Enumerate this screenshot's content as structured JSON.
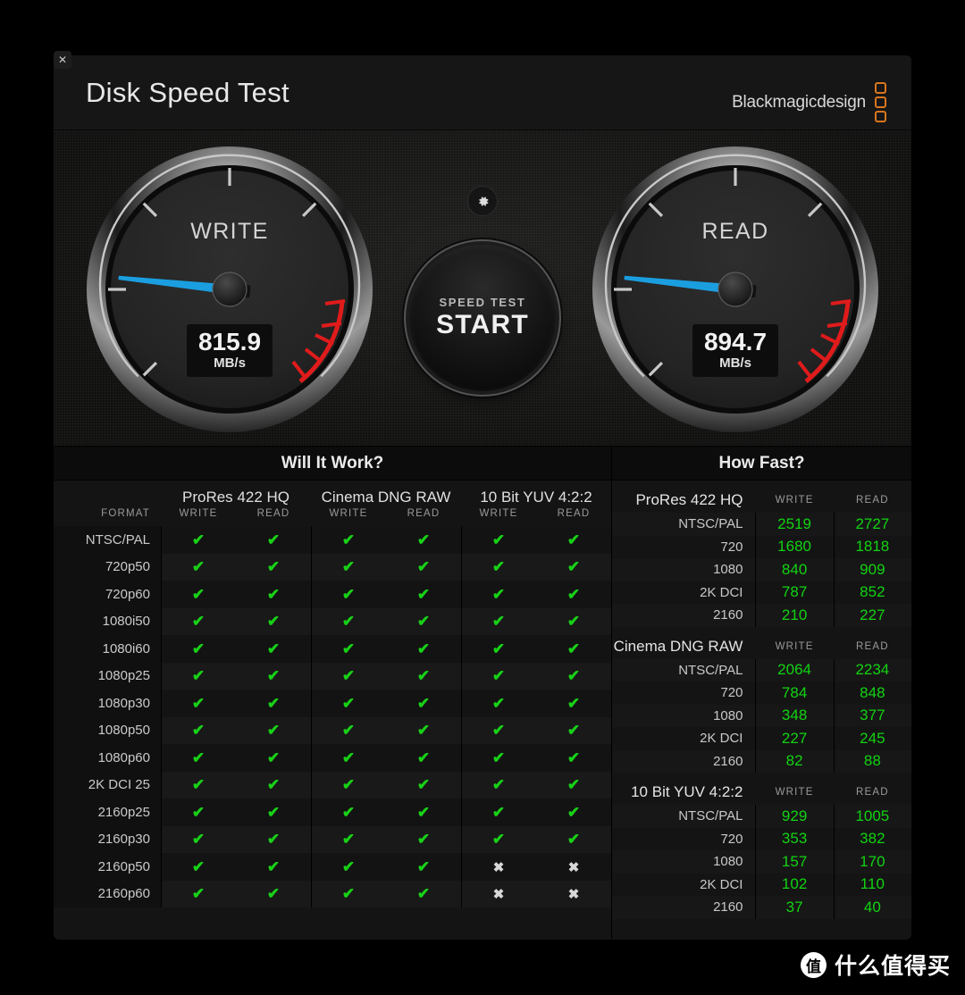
{
  "window": {
    "close_label": "✕",
    "title": "Disk Speed Test",
    "brand": "Blackmagicdesign"
  },
  "gauges": {
    "write": {
      "label": "WRITE",
      "value": "815.9",
      "unit": "MB/s",
      "needle_deg": 186
    },
    "read": {
      "label": "READ",
      "value": "894.7",
      "unit": "MB/s",
      "needle_deg": 186
    }
  },
  "center": {
    "gear_icon": "gear-icon",
    "start_small": "SPEED TEST",
    "start_big": "START"
  },
  "will_it_work": {
    "title": "Will It Work?",
    "format_header": "FORMAT",
    "groups": [
      {
        "name": "ProRes 422 HQ",
        "write": "WRITE",
        "read": "READ"
      },
      {
        "name": "Cinema DNG RAW",
        "write": "WRITE",
        "read": "READ"
      },
      {
        "name": "10 Bit YUV 4:2:2",
        "write": "WRITE",
        "read": "READ"
      }
    ],
    "ok_mark": "✔",
    "no_mark": "✖",
    "rows": [
      {
        "format": "NTSC/PAL",
        "marks": [
          true,
          true,
          true,
          true,
          true,
          true
        ]
      },
      {
        "format": "720p50",
        "marks": [
          true,
          true,
          true,
          true,
          true,
          true
        ]
      },
      {
        "format": "720p60",
        "marks": [
          true,
          true,
          true,
          true,
          true,
          true
        ]
      },
      {
        "format": "1080i50",
        "marks": [
          true,
          true,
          true,
          true,
          true,
          true
        ]
      },
      {
        "format": "1080i60",
        "marks": [
          true,
          true,
          true,
          true,
          true,
          true
        ]
      },
      {
        "format": "1080p25",
        "marks": [
          true,
          true,
          true,
          true,
          true,
          true
        ]
      },
      {
        "format": "1080p30",
        "marks": [
          true,
          true,
          true,
          true,
          true,
          true
        ]
      },
      {
        "format": "1080p50",
        "marks": [
          true,
          true,
          true,
          true,
          true,
          true
        ]
      },
      {
        "format": "1080p60",
        "marks": [
          true,
          true,
          true,
          true,
          true,
          true
        ]
      },
      {
        "format": "2K DCI 25",
        "marks": [
          true,
          true,
          true,
          true,
          true,
          true
        ]
      },
      {
        "format": "2160p25",
        "marks": [
          true,
          true,
          true,
          true,
          true,
          true
        ]
      },
      {
        "format": "2160p30",
        "marks": [
          true,
          true,
          true,
          true,
          true,
          true
        ]
      },
      {
        "format": "2160p50",
        "marks": [
          true,
          true,
          true,
          true,
          false,
          false
        ]
      },
      {
        "format": "2160p60",
        "marks": [
          true,
          true,
          true,
          true,
          false,
          false
        ]
      }
    ]
  },
  "how_fast": {
    "title": "How Fast?",
    "write_header": "WRITE",
    "read_header": "READ",
    "sections": [
      {
        "name": "ProRes 422 HQ",
        "rows": [
          {
            "label": "NTSC/PAL",
            "write": "2519",
            "read": "2727"
          },
          {
            "label": "720",
            "write": "1680",
            "read": "1818"
          },
          {
            "label": "1080",
            "write": "840",
            "read": "909"
          },
          {
            "label": "2K DCI",
            "write": "787",
            "read": "852"
          },
          {
            "label": "2160",
            "write": "210",
            "read": "227"
          }
        ]
      },
      {
        "name": "Cinema DNG RAW",
        "rows": [
          {
            "label": "NTSC/PAL",
            "write": "2064",
            "read": "2234"
          },
          {
            "label": "720",
            "write": "784",
            "read": "848"
          },
          {
            "label": "1080",
            "write": "348",
            "read": "377"
          },
          {
            "label": "2K DCI",
            "write": "227",
            "read": "245"
          },
          {
            "label": "2160",
            "write": "82",
            "read": "88"
          }
        ]
      },
      {
        "name": "10 Bit YUV 4:2:2",
        "rows": [
          {
            "label": "NTSC/PAL",
            "write": "929",
            "read": "1005"
          },
          {
            "label": "720",
            "write": "353",
            "read": "382"
          },
          {
            "label": "1080",
            "write": "157",
            "read": "170"
          },
          {
            "label": "2K DCI",
            "write": "102",
            "read": "110"
          },
          {
            "label": "2160",
            "write": "37",
            "read": "40"
          }
        ]
      }
    ]
  },
  "watermark": {
    "badge": "值",
    "text": "什么值得买"
  },
  "colors": {
    "needle": "#1a9ee0",
    "redzone": "#e01b1b",
    "ok_green": "#18d117",
    "value_green": "#12d312",
    "brand_orange": "#d8761e"
  }
}
